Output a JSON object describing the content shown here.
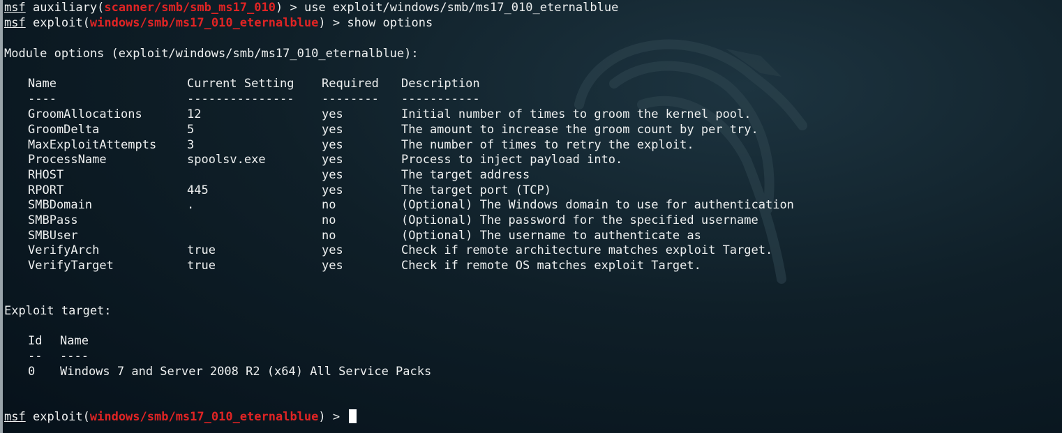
{
  "prompt": {
    "msf_label": "msf",
    "arrow": " >",
    "line1": {
      "context": "auxiliary",
      "module": "scanner/smb/smb_ms17_010",
      "command": "use exploit/windows/smb/ms17_010_eternalblue"
    },
    "line2": {
      "context": "exploit",
      "module": "windows/smb/ms17_010_eternalblue",
      "command": "show options"
    },
    "final": {
      "context": "exploit",
      "module": "windows/smb/ms17_010_eternalblue"
    }
  },
  "module_options": {
    "heading": "Module options (exploit/windows/smb/ms17_010_eternalblue):",
    "headers": {
      "name": "Name",
      "setting": "Current Setting",
      "required": "Required",
      "description": "Description"
    },
    "separators": {
      "name": "----",
      "setting": "---------------",
      "required": "--------",
      "description": "-----------"
    },
    "rows": [
      {
        "name": "GroomAllocations",
        "setting": "12",
        "required": "yes",
        "description": "Initial number of times to groom the kernel pool."
      },
      {
        "name": "GroomDelta",
        "setting": "5",
        "required": "yes",
        "description": "The amount to increase the groom count by per try."
      },
      {
        "name": "MaxExploitAttempts",
        "setting": "3",
        "required": "yes",
        "description": "The number of times to retry the exploit."
      },
      {
        "name": "ProcessName",
        "setting": "spoolsv.exe",
        "required": "yes",
        "description": "Process to inject payload into."
      },
      {
        "name": "RHOST",
        "setting": "",
        "required": "yes",
        "description": "The target address"
      },
      {
        "name": "RPORT",
        "setting": "445",
        "required": "yes",
        "description": "The target port (TCP)"
      },
      {
        "name": "SMBDomain",
        "setting": ".",
        "required": "no",
        "description": "(Optional) The Windows domain to use for authentication"
      },
      {
        "name": "SMBPass",
        "setting": "",
        "required": "no",
        "description": "(Optional) The password for the specified username"
      },
      {
        "name": "SMBUser",
        "setting": "",
        "required": "no",
        "description": "(Optional) The username to authenticate as"
      },
      {
        "name": "VerifyArch",
        "setting": "true",
        "required": "yes",
        "description": "Check if remote architecture matches exploit Target."
      },
      {
        "name": "VerifyTarget",
        "setting": "true",
        "required": "yes",
        "description": "Check if remote OS matches exploit Target."
      }
    ]
  },
  "exploit_target": {
    "heading": "Exploit target:",
    "headers": {
      "id": "Id",
      "name": "Name"
    },
    "separators": {
      "id": "--",
      "name": "----"
    },
    "rows": [
      {
        "id": "0",
        "name": "Windows 7 and Server 2008 R2 (x64) All Service Packs"
      }
    ]
  },
  "colors": {
    "background": "#0f1f28",
    "text": "#eef0f0",
    "module_highlight": "#e02424",
    "cursor": "#ffffff"
  },
  "icons": {
    "background": "kali-dragon-watermark",
    "cursor": "block-cursor"
  }
}
